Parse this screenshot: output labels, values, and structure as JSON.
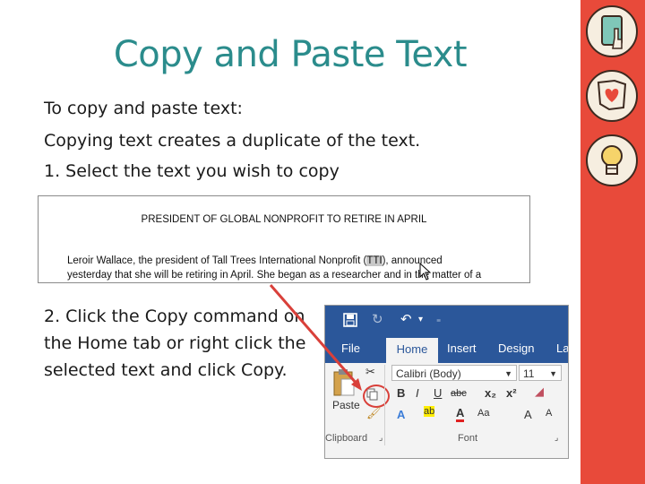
{
  "title": "Copy and Paste Text",
  "body": {
    "line1": "To copy and paste text:",
    "line2": "Copying text creates a duplicate of the text.",
    "line3": "1.  Select the text you wish to copy",
    "step2": "2.  Click the Copy command on the Home tab or right click the selected text and click Copy."
  },
  "article": {
    "headline": "PRESIDENT OF GLOBAL NONPROFIT TO RETIRE IN APRIL",
    "p1_before": "Leroir Wallace, the president of Tall Trees International Nonprofit (",
    "p1_selected": "TTI",
    "p1_after": "), announced",
    "p2": "yesterday that she will be retiring in April. She began as a researcher and in the matter of a"
  },
  "ribbon": {
    "tabs": [
      "File",
      "Home",
      "Insert",
      "Design",
      "La"
    ],
    "active_tab": "Home",
    "font_name": "Calibri (Body)",
    "font_size": "11",
    "paste_label": "Paste",
    "clipboard_label": "Clipboard",
    "font_group_label": "Font",
    "bold": "B",
    "italic": "I",
    "underline": "U",
    "strike": "abc",
    "subscript": "x₂",
    "superscript": "x²"
  },
  "sidebar_icons": [
    "tablet-touch-icon",
    "ohio-heart-icon",
    "lightbulb-icon"
  ],
  "colors": {
    "title": "#2b8c8c",
    "sidebar": "#e84a3a",
    "ribbon": "#2b579a",
    "annotation": "#d9403a"
  }
}
